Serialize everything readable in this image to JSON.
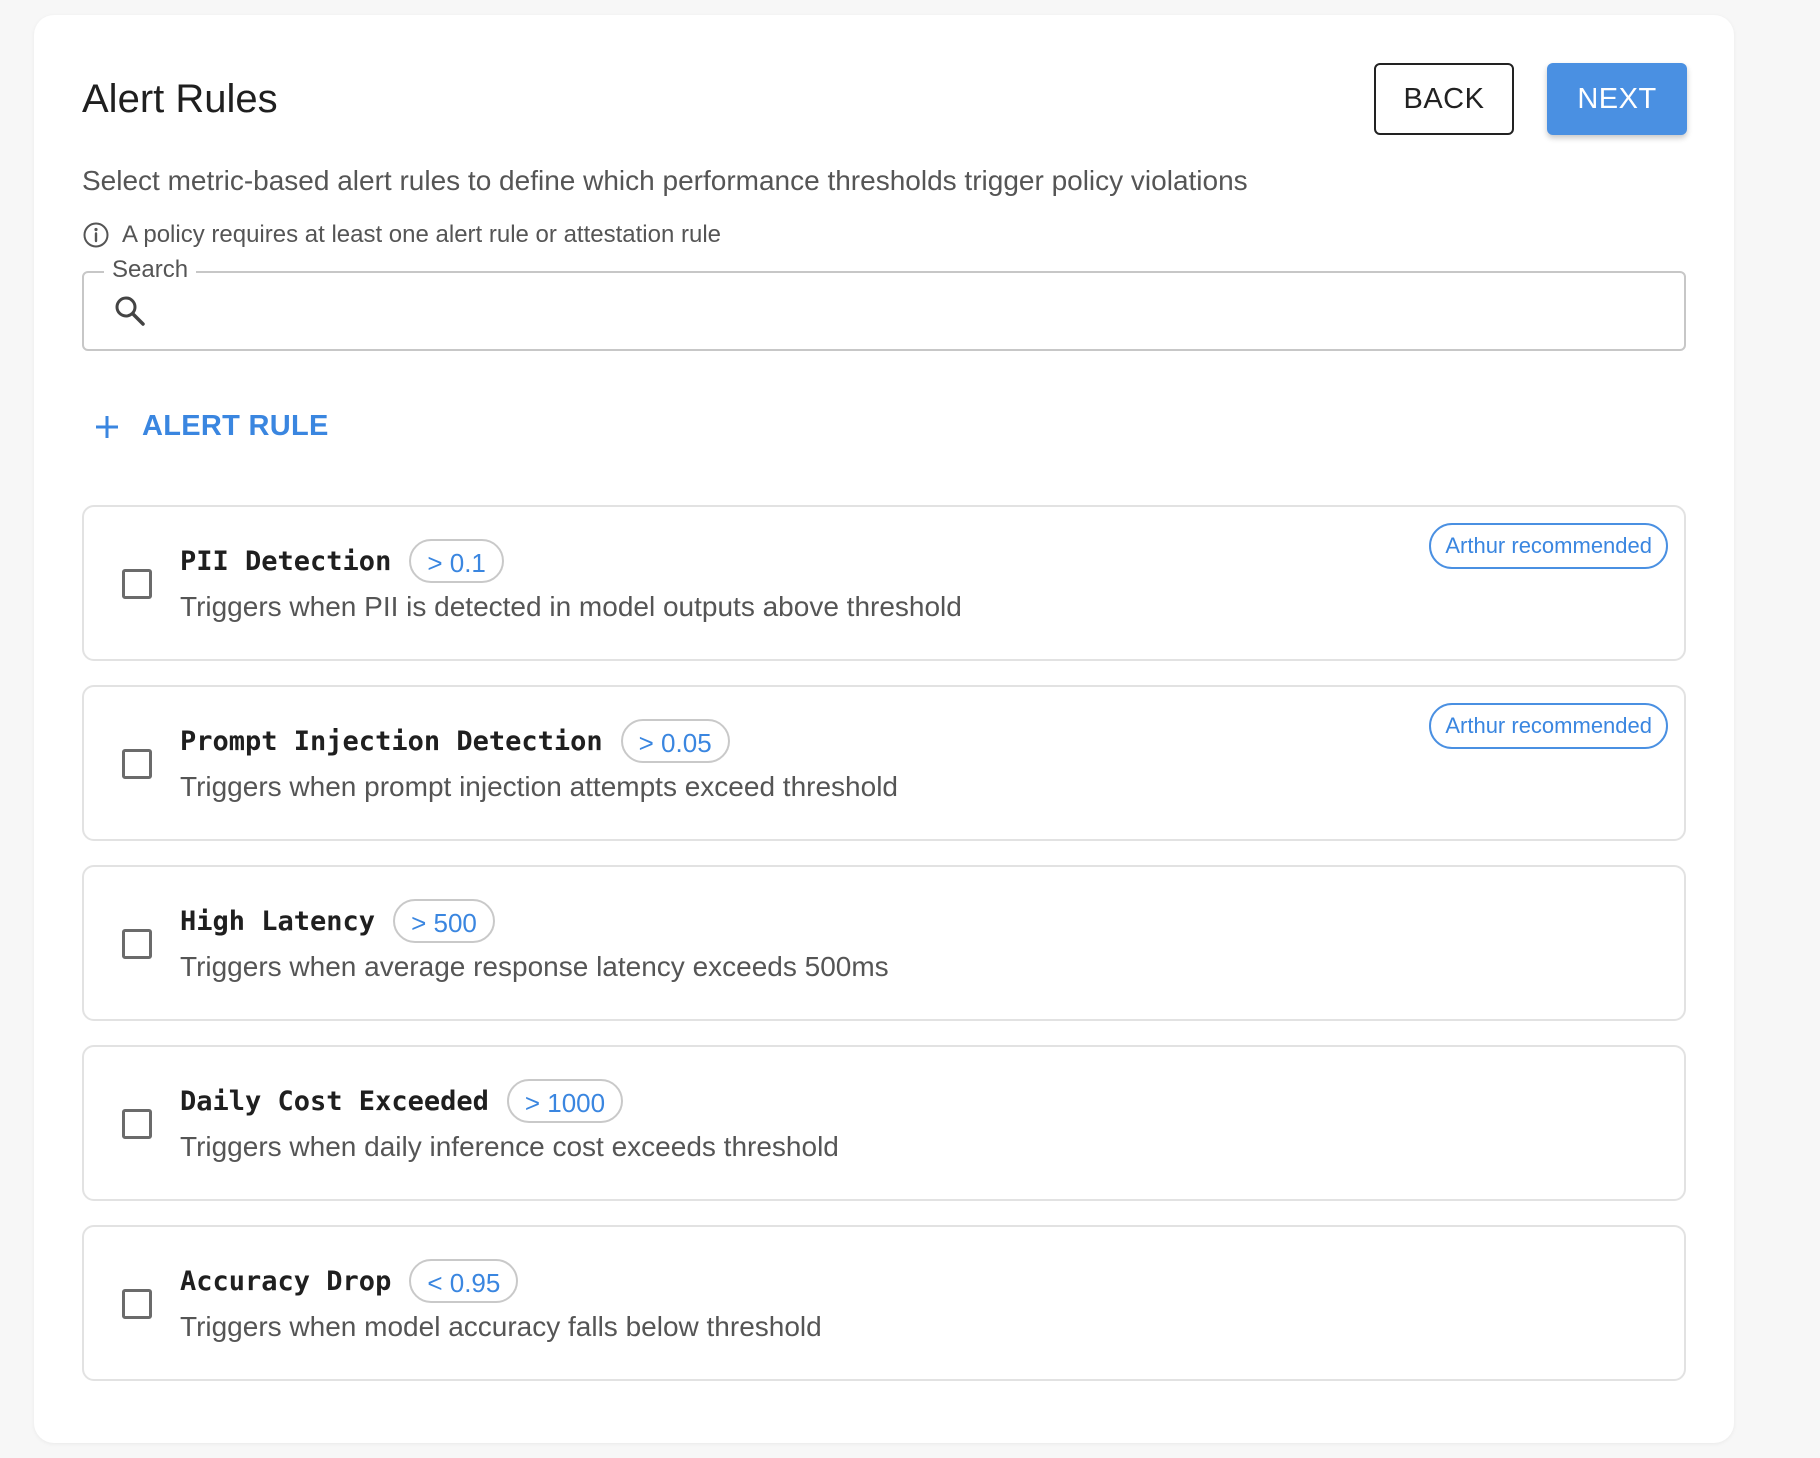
{
  "header": {
    "title": "Alert Rules",
    "back_label": "BACK",
    "next_label": "NEXT",
    "subtitle": "Select metric-based alert rules to define which performance thresholds trigger policy violations",
    "info_text": "A policy requires at least one alert rule or attestation rule"
  },
  "search": {
    "label": "Search",
    "value": "",
    "placeholder": ""
  },
  "add_rule": {
    "label": "ALERT RULE",
    "icon": "plus-icon"
  },
  "rules": [
    {
      "name": "PII Detection",
      "threshold": "> 0.1",
      "description": "Triggers when PII is detected in model outputs above threshold",
      "badge": "Arthur recommended",
      "checked": false
    },
    {
      "name": "Prompt Injection Detection",
      "threshold": "> 0.05",
      "description": "Triggers when prompt injection attempts exceed threshold",
      "badge": "Arthur recommended",
      "checked": false
    },
    {
      "name": "High Latency",
      "threshold": "> 500",
      "description": "Triggers when average response latency exceeds 500ms",
      "checked": false
    },
    {
      "name": "Daily Cost Exceeded",
      "threshold": "> 1000",
      "description": "Triggers when daily inference cost exceeds threshold",
      "checked": false
    },
    {
      "name": "Accuracy Drop",
      "threshold": "< 0.95",
      "description": "Triggers when model accuracy falls below threshold",
      "checked": false
    }
  ],
  "colors": {
    "accent": "#4a90e2",
    "link": "#3a86e0",
    "text": "#1f1f1f",
    "muted": "#555555",
    "border": "#e2e2e2"
  }
}
